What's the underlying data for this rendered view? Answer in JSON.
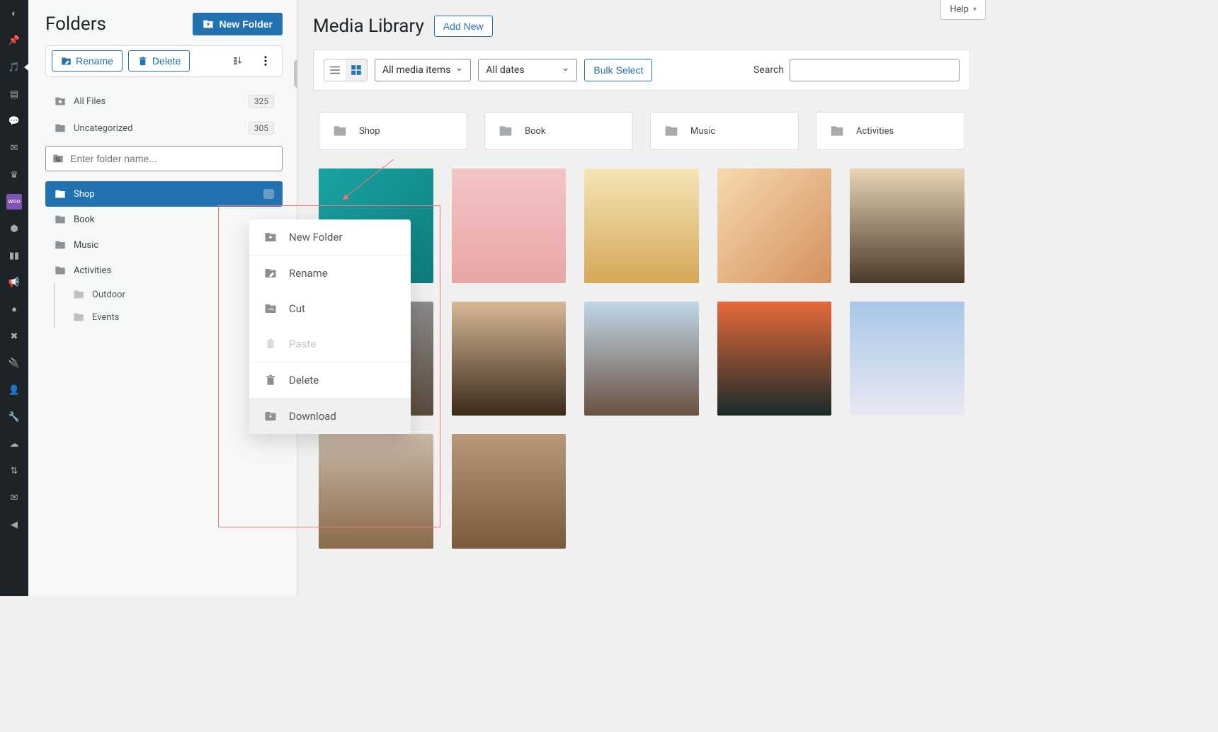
{
  "help_label": "Help",
  "folders": {
    "title": "Folders",
    "new_folder_btn": "New Folder",
    "rename_btn": "Rename",
    "delete_btn": "Delete",
    "all_files": {
      "label": "All Files",
      "count": "325"
    },
    "uncategorized": {
      "label": "Uncategorized",
      "count": "305"
    },
    "search_placeholder": "Enter folder name...",
    "tree": [
      {
        "label": "Shop",
        "selected": true
      },
      {
        "label": "Book"
      },
      {
        "label": "Music"
      },
      {
        "label": "Activities",
        "children": [
          {
            "label": "Outdoor"
          },
          {
            "label": "Events"
          }
        ]
      }
    ]
  },
  "context_menu": {
    "items": [
      {
        "label": "New Folder",
        "icon": "folder-plus"
      },
      {
        "label": "Rename",
        "icon": "rename"
      },
      {
        "label": "Cut",
        "icon": "cut"
      },
      {
        "label": "Paste",
        "icon": "paste",
        "disabled": true
      },
      {
        "label": "Delete",
        "icon": "trash"
      },
      {
        "label": "Download",
        "icon": "download",
        "hovered": true
      }
    ]
  },
  "media": {
    "title": "Media Library",
    "add_new": "Add New",
    "filter_type": "All media items",
    "filter_date": "All dates",
    "bulk_select": "Bulk Select",
    "search_label": "Search",
    "folder_cards": [
      "Shop",
      "Book",
      "Music",
      "Activities"
    ]
  }
}
